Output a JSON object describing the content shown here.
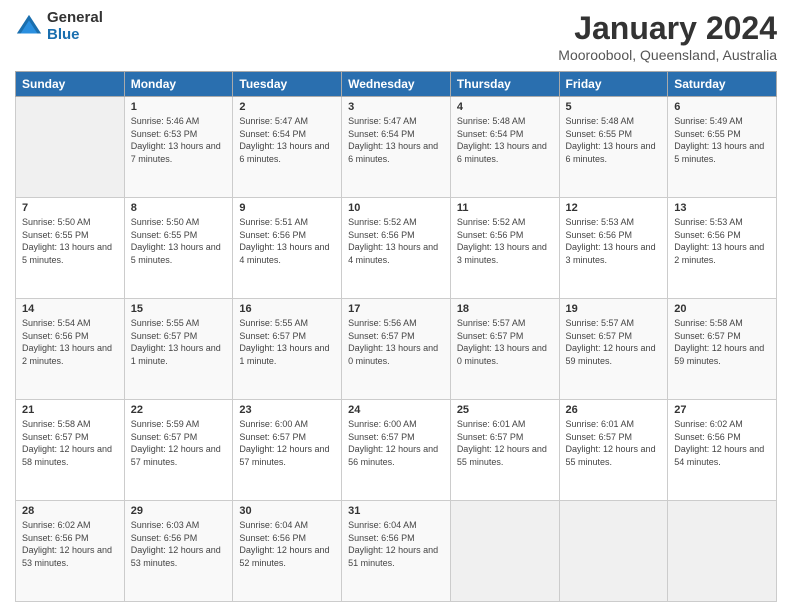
{
  "logo": {
    "general": "General",
    "blue": "Blue"
  },
  "header": {
    "title": "January 2024",
    "subtitle": "Mooroobool, Queensland, Australia"
  },
  "weekdays": [
    "Sunday",
    "Monday",
    "Tuesday",
    "Wednesday",
    "Thursday",
    "Friday",
    "Saturday"
  ],
  "weeks": [
    [
      {
        "day": null
      },
      {
        "day": "1",
        "sunrise": "5:46 AM",
        "sunset": "6:53 PM",
        "daylight": "13 hours and 7 minutes."
      },
      {
        "day": "2",
        "sunrise": "5:47 AM",
        "sunset": "6:54 PM",
        "daylight": "13 hours and 6 minutes."
      },
      {
        "day": "3",
        "sunrise": "5:47 AM",
        "sunset": "6:54 PM",
        "daylight": "13 hours and 6 minutes."
      },
      {
        "day": "4",
        "sunrise": "5:48 AM",
        "sunset": "6:54 PM",
        "daylight": "13 hours and 6 minutes."
      },
      {
        "day": "5",
        "sunrise": "5:48 AM",
        "sunset": "6:55 PM",
        "daylight": "13 hours and 6 minutes."
      },
      {
        "day": "6",
        "sunrise": "5:49 AM",
        "sunset": "6:55 PM",
        "daylight": "13 hours and 5 minutes."
      }
    ],
    [
      {
        "day": "7",
        "sunrise": "5:50 AM",
        "sunset": "6:55 PM",
        "daylight": "13 hours and 5 minutes."
      },
      {
        "day": "8",
        "sunrise": "5:50 AM",
        "sunset": "6:55 PM",
        "daylight": "13 hours and 5 minutes."
      },
      {
        "day": "9",
        "sunrise": "5:51 AM",
        "sunset": "6:56 PM",
        "daylight": "13 hours and 4 minutes."
      },
      {
        "day": "10",
        "sunrise": "5:52 AM",
        "sunset": "6:56 PM",
        "daylight": "13 hours and 4 minutes."
      },
      {
        "day": "11",
        "sunrise": "5:52 AM",
        "sunset": "6:56 PM",
        "daylight": "13 hours and 3 minutes."
      },
      {
        "day": "12",
        "sunrise": "5:53 AM",
        "sunset": "6:56 PM",
        "daylight": "13 hours and 3 minutes."
      },
      {
        "day": "13",
        "sunrise": "5:53 AM",
        "sunset": "6:56 PM",
        "daylight": "13 hours and 2 minutes."
      }
    ],
    [
      {
        "day": "14",
        "sunrise": "5:54 AM",
        "sunset": "6:56 PM",
        "daylight": "13 hours and 2 minutes."
      },
      {
        "day": "15",
        "sunrise": "5:55 AM",
        "sunset": "6:57 PM",
        "daylight": "13 hours and 1 minute."
      },
      {
        "day": "16",
        "sunrise": "5:55 AM",
        "sunset": "6:57 PM",
        "daylight": "13 hours and 1 minute."
      },
      {
        "day": "17",
        "sunrise": "5:56 AM",
        "sunset": "6:57 PM",
        "daylight": "13 hours and 0 minutes."
      },
      {
        "day": "18",
        "sunrise": "5:57 AM",
        "sunset": "6:57 PM",
        "daylight": "13 hours and 0 minutes."
      },
      {
        "day": "19",
        "sunrise": "5:57 AM",
        "sunset": "6:57 PM",
        "daylight": "12 hours and 59 minutes."
      },
      {
        "day": "20",
        "sunrise": "5:58 AM",
        "sunset": "6:57 PM",
        "daylight": "12 hours and 59 minutes."
      }
    ],
    [
      {
        "day": "21",
        "sunrise": "5:58 AM",
        "sunset": "6:57 PM",
        "daylight": "12 hours and 58 minutes."
      },
      {
        "day": "22",
        "sunrise": "5:59 AM",
        "sunset": "6:57 PM",
        "daylight": "12 hours and 57 minutes."
      },
      {
        "day": "23",
        "sunrise": "6:00 AM",
        "sunset": "6:57 PM",
        "daylight": "12 hours and 57 minutes."
      },
      {
        "day": "24",
        "sunrise": "6:00 AM",
        "sunset": "6:57 PM",
        "daylight": "12 hours and 56 minutes."
      },
      {
        "day": "25",
        "sunrise": "6:01 AM",
        "sunset": "6:57 PM",
        "daylight": "12 hours and 55 minutes."
      },
      {
        "day": "26",
        "sunrise": "6:01 AM",
        "sunset": "6:57 PM",
        "daylight": "12 hours and 55 minutes."
      },
      {
        "day": "27",
        "sunrise": "6:02 AM",
        "sunset": "6:56 PM",
        "daylight": "12 hours and 54 minutes."
      }
    ],
    [
      {
        "day": "28",
        "sunrise": "6:02 AM",
        "sunset": "6:56 PM",
        "daylight": "12 hours and 53 minutes."
      },
      {
        "day": "29",
        "sunrise": "6:03 AM",
        "sunset": "6:56 PM",
        "daylight": "12 hours and 53 minutes."
      },
      {
        "day": "30",
        "sunrise": "6:04 AM",
        "sunset": "6:56 PM",
        "daylight": "12 hours and 52 minutes."
      },
      {
        "day": "31",
        "sunrise": "6:04 AM",
        "sunset": "6:56 PM",
        "daylight": "12 hours and 51 minutes."
      },
      {
        "day": null
      },
      {
        "day": null
      },
      {
        "day": null
      }
    ]
  ]
}
